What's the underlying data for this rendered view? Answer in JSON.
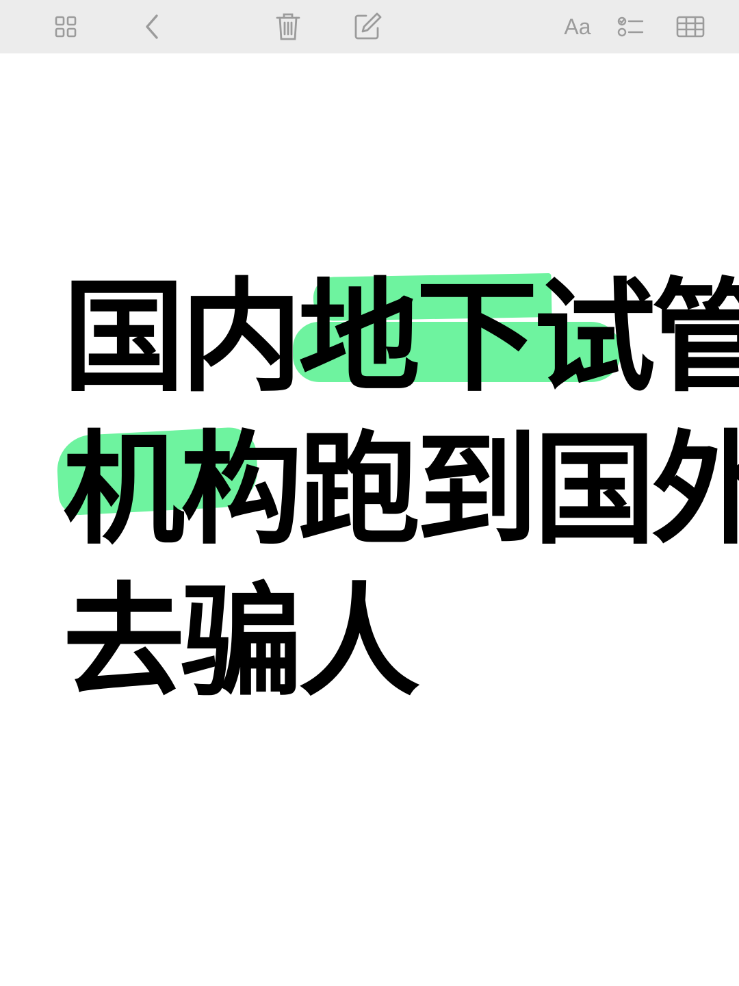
{
  "toolbar": {
    "buttons": [
      {
        "name": "gallery",
        "icon": "grid-icon"
      },
      {
        "name": "back",
        "icon": "chevron-left-icon"
      },
      {
        "name": "delete",
        "icon": "trash-icon"
      },
      {
        "name": "compose",
        "icon": "compose-icon"
      },
      {
        "name": "format",
        "icon": "text-format-icon",
        "label": "Aa"
      },
      {
        "name": "checklist",
        "icon": "checklist-icon"
      },
      {
        "name": "table",
        "icon": "table-icon"
      }
    ],
    "icon_color": "#9b9b9b",
    "background": "#ececec"
  },
  "note": {
    "lines": [
      "国内地下试管",
      "机构跑到国外",
      "去骗人"
    ],
    "highlight_color": "#6ef39f",
    "text_color": "#000000"
  }
}
